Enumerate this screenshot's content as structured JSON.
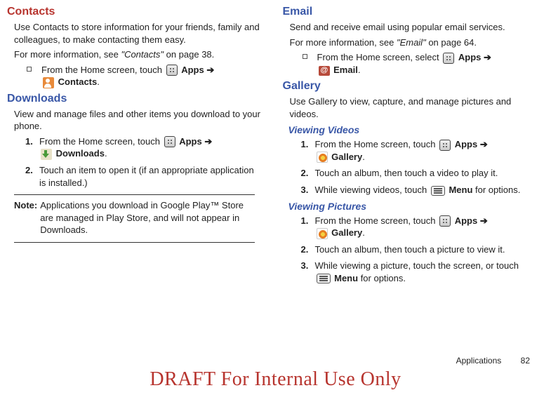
{
  "left": {
    "contacts": {
      "title": "Contacts",
      "p1": "Use Contacts to store information for your friends, family and colleagues, to make contacting them easy.",
      "p2a": "For more information, see ",
      "p2quote": "\"Contacts\"",
      "p2b": " on page 38.",
      "bullet_a": "From the Home screen, touch ",
      "apps": "Apps",
      "arrow": " ➔",
      "contacts_label": "Contacts",
      "period": "."
    },
    "downloads": {
      "title": "Downloads",
      "p1": "View and manage files and other items you download to your phone.",
      "step1a": "From the Home screen, touch ",
      "apps": "Apps",
      "arrow": " ➔",
      "downloads_label": "Downloads",
      "period": ".",
      "step2": "Touch an item to open it (if an appropriate application is installed.)",
      "note_label": "Note:",
      "note_text": "Applications you download in Google Play™ Store are managed in Play Store, and will not appear in Downloads."
    }
  },
  "right": {
    "email": {
      "title": "Email",
      "p1": "Send and receive email using popular email services.",
      "p2a": "For more information, see ",
      "p2quote": "\"Email\"",
      "p2b": " on page 64.",
      "bullet_a": "From the Home screen, select ",
      "apps": "Apps",
      "arrow": " ➔",
      "email_label": "Email",
      "period": "."
    },
    "gallery": {
      "title": "Gallery",
      "p1": "Use Gallery to view, capture, and manage pictures and videos."
    },
    "viewing_videos": {
      "title": "Viewing Videos",
      "step1a": "From the Home screen, touch ",
      "apps": "Apps",
      "arrow": " ➔",
      "gallery_label": "Gallery",
      "period": ".",
      "step2": "Touch an album, then touch a video to play it.",
      "step3a": "While viewing videos, touch ",
      "menu": "Menu",
      "step3b": " for options."
    },
    "viewing_pictures": {
      "title": "Viewing Pictures",
      "step1a": "From the Home screen, touch ",
      "apps": "Apps",
      "arrow": " ➔",
      "gallery_label": "Gallery",
      "period": ".",
      "step2": "Touch an album, then touch a picture to view it.",
      "step3a": "While viewing a picture, touch the screen, or touch ",
      "menu": "Menu",
      "step3b": " for options."
    }
  },
  "numbers": {
    "n1": "1.",
    "n2": "2.",
    "n3": "3."
  },
  "footer": {
    "section": "Applications",
    "page": "82"
  },
  "watermark": "DRAFT For Internal Use Only"
}
